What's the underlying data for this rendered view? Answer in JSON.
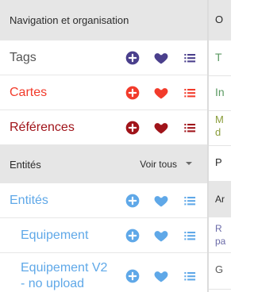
{
  "nav_section": {
    "title": "Navigation et organisation",
    "items": [
      {
        "label": "Tags",
        "color": "#4a3f8c"
      },
      {
        "label": "Cartes",
        "color": "#f23b2b"
      },
      {
        "label": "Références",
        "color": "#a0141a"
      }
    ]
  },
  "entities_section": {
    "title": "Entités",
    "view_all": "Voir tous",
    "items": [
      {
        "label": "Entités",
        "color": "#5fa8e8"
      },
      {
        "label": "Equipement",
        "color": "#5fa8e8"
      },
      {
        "label": "Equipement V2 - no upload",
        "color": "#5fa8e8"
      }
    ]
  },
  "right_panel": {
    "header_letter": "O",
    "items": [
      "T",
      "In",
      "M d",
      "P"
    ],
    "header2_letter": "Ar",
    "items2": [
      "R pa",
      "G"
    ]
  },
  "icons": {
    "add": "plus-circle-icon",
    "favorite": "heart-icon",
    "list": "list-icon",
    "dropdown": "caret-down-icon"
  }
}
